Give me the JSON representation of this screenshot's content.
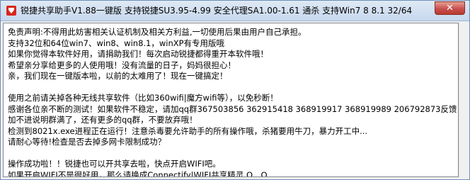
{
  "window": {
    "title": "锐捷共享助手V1.88一键版 支持锐捷SU3.95-4.99 安全代理SA1.00-1.61 通杀 支持Win7 8 8.1 32/64",
    "close_label": "✕"
  },
  "content": {
    "paragraph1": [
      "免责声明:不得用此妨害相关认证机制及相关方利益,一切使用后果由用户自己承担。",
      "支持32位和64位win7、win8、win8.1，winXP有专用版哦",
      "如果你觉得本软件好用，请捐助我们！每次启动锐捷都得重开本软件哦！",
      "希望亲分享给更多的人使用哦！没有流量的日子，妈妈很担心！",
      "亲，我们现在一键版本啦，以前的太难用了！现在一键搞定！"
    ],
    "paragraph2": [
      "使用之前请关掉各种无线共享软件（比如360wifi|魔方wifi等），以免秒断！",
      "感谢各位亲不断的测试！如果软件不稳定，请加qq群367503856 362915418 368919917 368919989 206792873反馈",
      "加不进说明群满了，还有更多的qq群，不要放弃哦！",
      "检测到8021x.exe进程正在运行！注意杀毒要允许助手的所有操作哦，杀猪要用牛刀，暴力开工中...",
      "请耐心等待!检查是否去掉多网卡限制成功？"
    ],
    "paragraph3": [
      "操作成功啦！！锐捷也可以开共享去啦，快点开启WIFI吧。",
      "如果开启WIFI不是很好用，那么请换成Connectify|WIFI共享精灵 O__O"
    ]
  },
  "colors": {
    "titlebar_top": "#dfe9f5",
    "titlebar_bottom": "#c7d8ee",
    "close_button": "#c75050",
    "icon_red": "#d9261c"
  },
  "icons": {
    "app": "app-logo-icon",
    "close": "close-icon"
  }
}
